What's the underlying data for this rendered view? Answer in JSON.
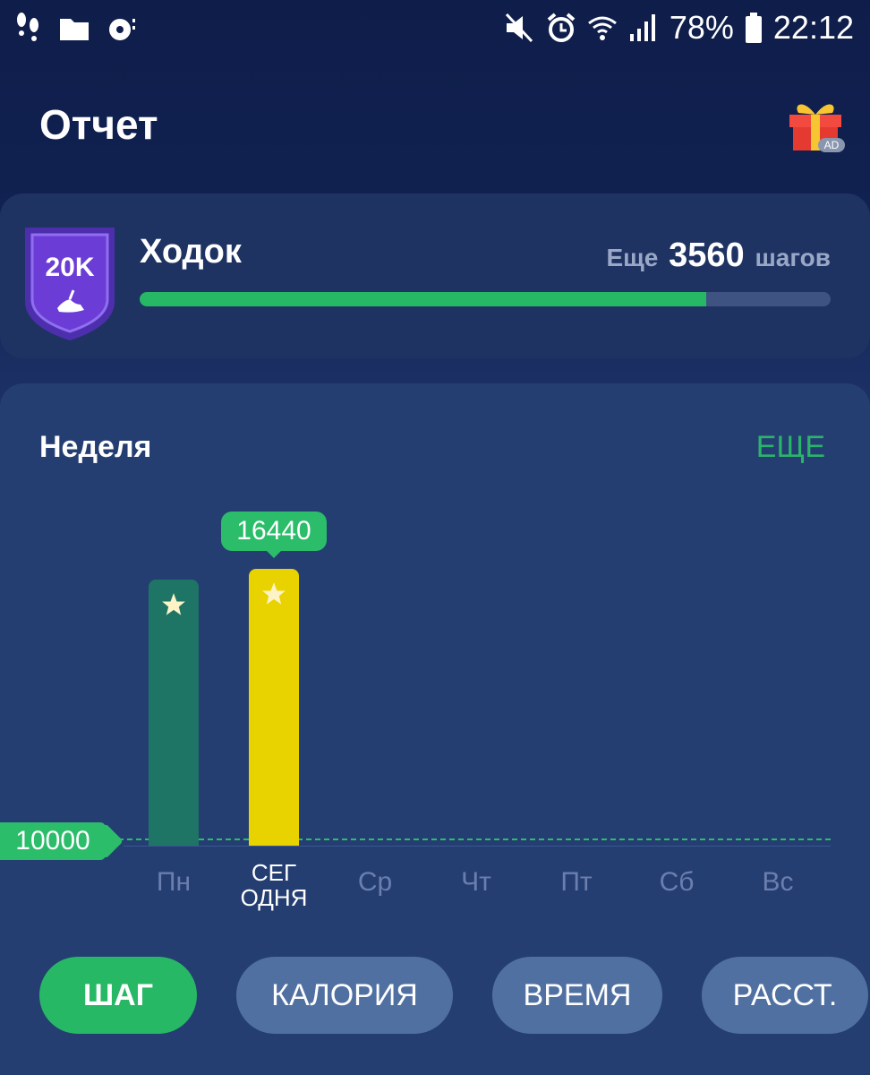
{
  "status_bar": {
    "battery": "78%",
    "time": "22:12",
    "left_icons": [
      "footsteps-icon",
      "folder-icon",
      "music-note-icon"
    ],
    "right_icons": [
      "mute-icon",
      "alarm-icon",
      "wifi-icon",
      "signal-icon",
      "battery-icon"
    ]
  },
  "header": {
    "title": "Отчет",
    "gift_badge": "AD"
  },
  "level": {
    "badge_text": "20K",
    "name": "Ходок",
    "remaining_prefix": "Еще",
    "remaining_steps": "3560",
    "remaining_suffix": "шагов",
    "progress_percent": 82
  },
  "week": {
    "title": "Неделя",
    "more_label": "ЕЩЕ",
    "goal_label": "10000",
    "tooltip_value": "16440",
    "days": [
      {
        "label": "Пн"
      },
      {
        "label": "СЕГ\nОДНЯ"
      },
      {
        "label": "Ср"
      },
      {
        "label": "Чт"
      },
      {
        "label": "Пт"
      },
      {
        "label": "Сб"
      },
      {
        "label": "Вс"
      }
    ]
  },
  "chart_data": {
    "type": "bar",
    "categories": [
      "Пн",
      "СЕГОДНЯ",
      "Ср",
      "Чт",
      "Пт",
      "Сб",
      "Вс"
    ],
    "values": [
      15800,
      16440,
      0,
      0,
      0,
      0,
      0
    ],
    "goal": 10000,
    "ylim": [
      0,
      18000
    ],
    "title": "Неделя",
    "colors": {
      "past": "#1e7566",
      "today": "#e8d200",
      "goal": "#2bbd6a"
    }
  },
  "tabs": [
    {
      "label": "ШАГ",
      "active": true
    },
    {
      "label": "КАЛОРИЯ",
      "active": false
    },
    {
      "label": "ВРЕМЯ",
      "active": false
    },
    {
      "label": "РАССТ.",
      "active": false
    }
  ]
}
